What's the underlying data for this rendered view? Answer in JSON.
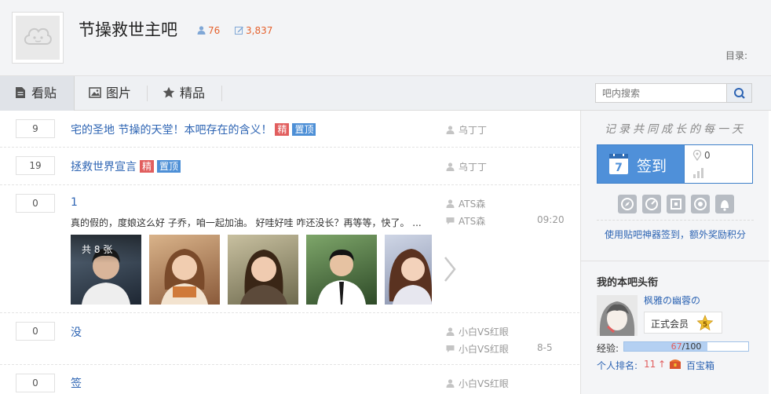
{
  "header": {
    "forum_name": "节操救世主吧",
    "member_count": "76",
    "post_count": "3,837",
    "directory_label": "目录:"
  },
  "tabs": [
    {
      "label": "看贴",
      "icon": "document-icon",
      "active": true
    },
    {
      "label": "图片",
      "icon": "picture-icon",
      "active": false
    },
    {
      "label": "精品",
      "icon": "star-icon",
      "active": false
    }
  ],
  "search": {
    "placeholder": "吧内搜索"
  },
  "threads": [
    {
      "replies": "9",
      "title": "宅的圣地 节操的天堂！本吧存在的含义！",
      "badges": [
        "精",
        "置顶"
      ],
      "author": "乌丁丁"
    },
    {
      "replies": "19",
      "title": "拯救世界宣言",
      "badges": [
        "精",
        "置顶"
      ],
      "author": "乌丁丁"
    },
    {
      "replies": "0",
      "title": "1",
      "abstract": "真的假的，度娘这么好 子乔，咱一起加油。 好哇好哇 咋还没长？再等等，快了。 ...",
      "author": "ATS森",
      "last_reply": "ATS森",
      "time": "09:20",
      "pic_count_label": "共 8 张"
    },
    {
      "replies": "0",
      "title": "没",
      "author": "小白VS红眼",
      "last_reply": "小白VS红眼",
      "time": "8-5"
    },
    {
      "replies": "0",
      "title": "签",
      "author": "小白VS红眼"
    }
  ],
  "sidebar": {
    "slogan": "记录共同成长的每一天",
    "sign_label": "签到",
    "sign_count": "0",
    "tool_link": "使用贴吧神器签到，额外奖励积分",
    "my_title": "我的本吧头衔",
    "user": {
      "name": "枫雅の幽蓉の",
      "rank": "正式会员",
      "level": "5",
      "exp_label": "经验:",
      "exp_current": "67",
      "exp_max": "/100",
      "exp_fraction": 0.67,
      "rank_label": "个人排名:",
      "rank_num": "11",
      "rank_up": "↑",
      "chest_label": "百宝箱"
    }
  },
  "colors": {
    "link": "#2d64b3",
    "accent": "#e5622e",
    "sign_blue": "#4f90d9",
    "badge_red": "#e15e5e",
    "badge_blue": "#4d8fd6"
  }
}
